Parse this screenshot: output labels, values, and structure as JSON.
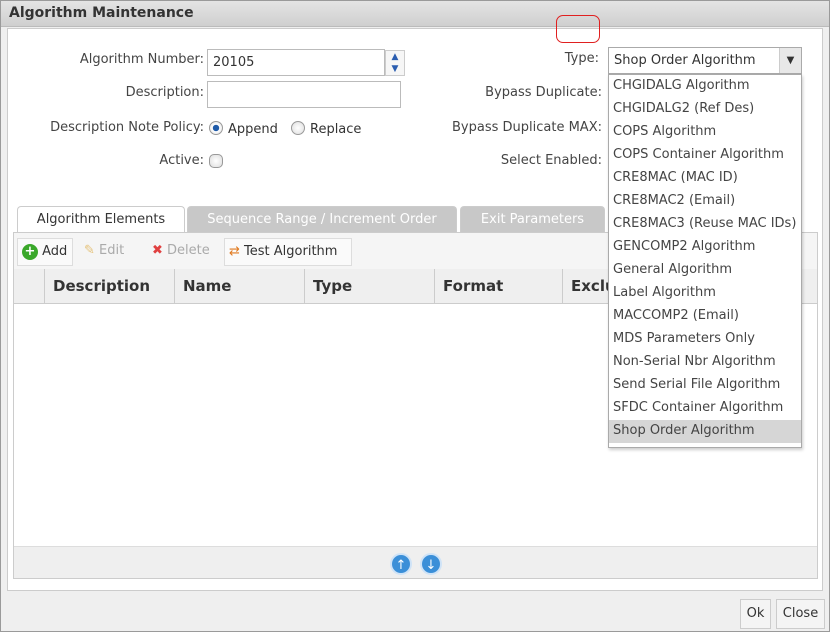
{
  "window": {
    "title": "Algorithm Maintenance"
  },
  "form": {
    "algorithm_number_label": "Algorithm Number:",
    "algorithm_number": "20105",
    "description_label": "Description:",
    "description": "",
    "note_policy_label": "Description Note Policy:",
    "note_policy_options": [
      "Append",
      "Replace"
    ],
    "note_policy_selected": "Append",
    "active_label": "Active:",
    "active": false,
    "type_label": "Type:",
    "type_value": "Shop Order Algorithm",
    "bypass_duplicate_label": "Bypass Duplicate:",
    "bypass_duplicate_max_label": "Bypass Duplicate MAX:",
    "select_enabled_label": "Select Enabled:"
  },
  "type_dropdown": {
    "options": [
      "CHGIDALG Algorithm",
      "CHGIDALG2 (Ref Des)",
      "COPS Algorithm",
      "COPS Container Algorithm",
      "CRE8MAC (MAC ID)",
      "CRE8MAC2 (Email)",
      "CRE8MAC3 (Reuse MAC IDs)",
      "GENCOMP2 Algorithm",
      "General Algorithm",
      "Label Algorithm",
      "MACCOMP2 (Email)",
      "MDS Parameters Only",
      "Non-Serial Nbr Algorithm",
      "Send Serial File Algorithm",
      "SFDC Container Algorithm",
      "Shop Order Algorithm"
    ],
    "selected": "Shop Order Algorithm"
  },
  "tabs": [
    {
      "label": "Algorithm Elements",
      "active": true
    },
    {
      "label": "Sequence Range / Increment Order"
    },
    {
      "label": "Exit Parameters"
    }
  ],
  "toolbar": {
    "add": "Add",
    "edit": "Edit",
    "delete": "Delete",
    "test": "Test Algorithm"
  },
  "grid": {
    "columns": [
      "Description",
      "Name",
      "Type",
      "Format",
      "Exclu"
    ]
  },
  "buttons": {
    "ok": "Ok",
    "close": "Close"
  },
  "colors": {
    "highlight": "#e02020",
    "accent": "#3b8fd8"
  }
}
